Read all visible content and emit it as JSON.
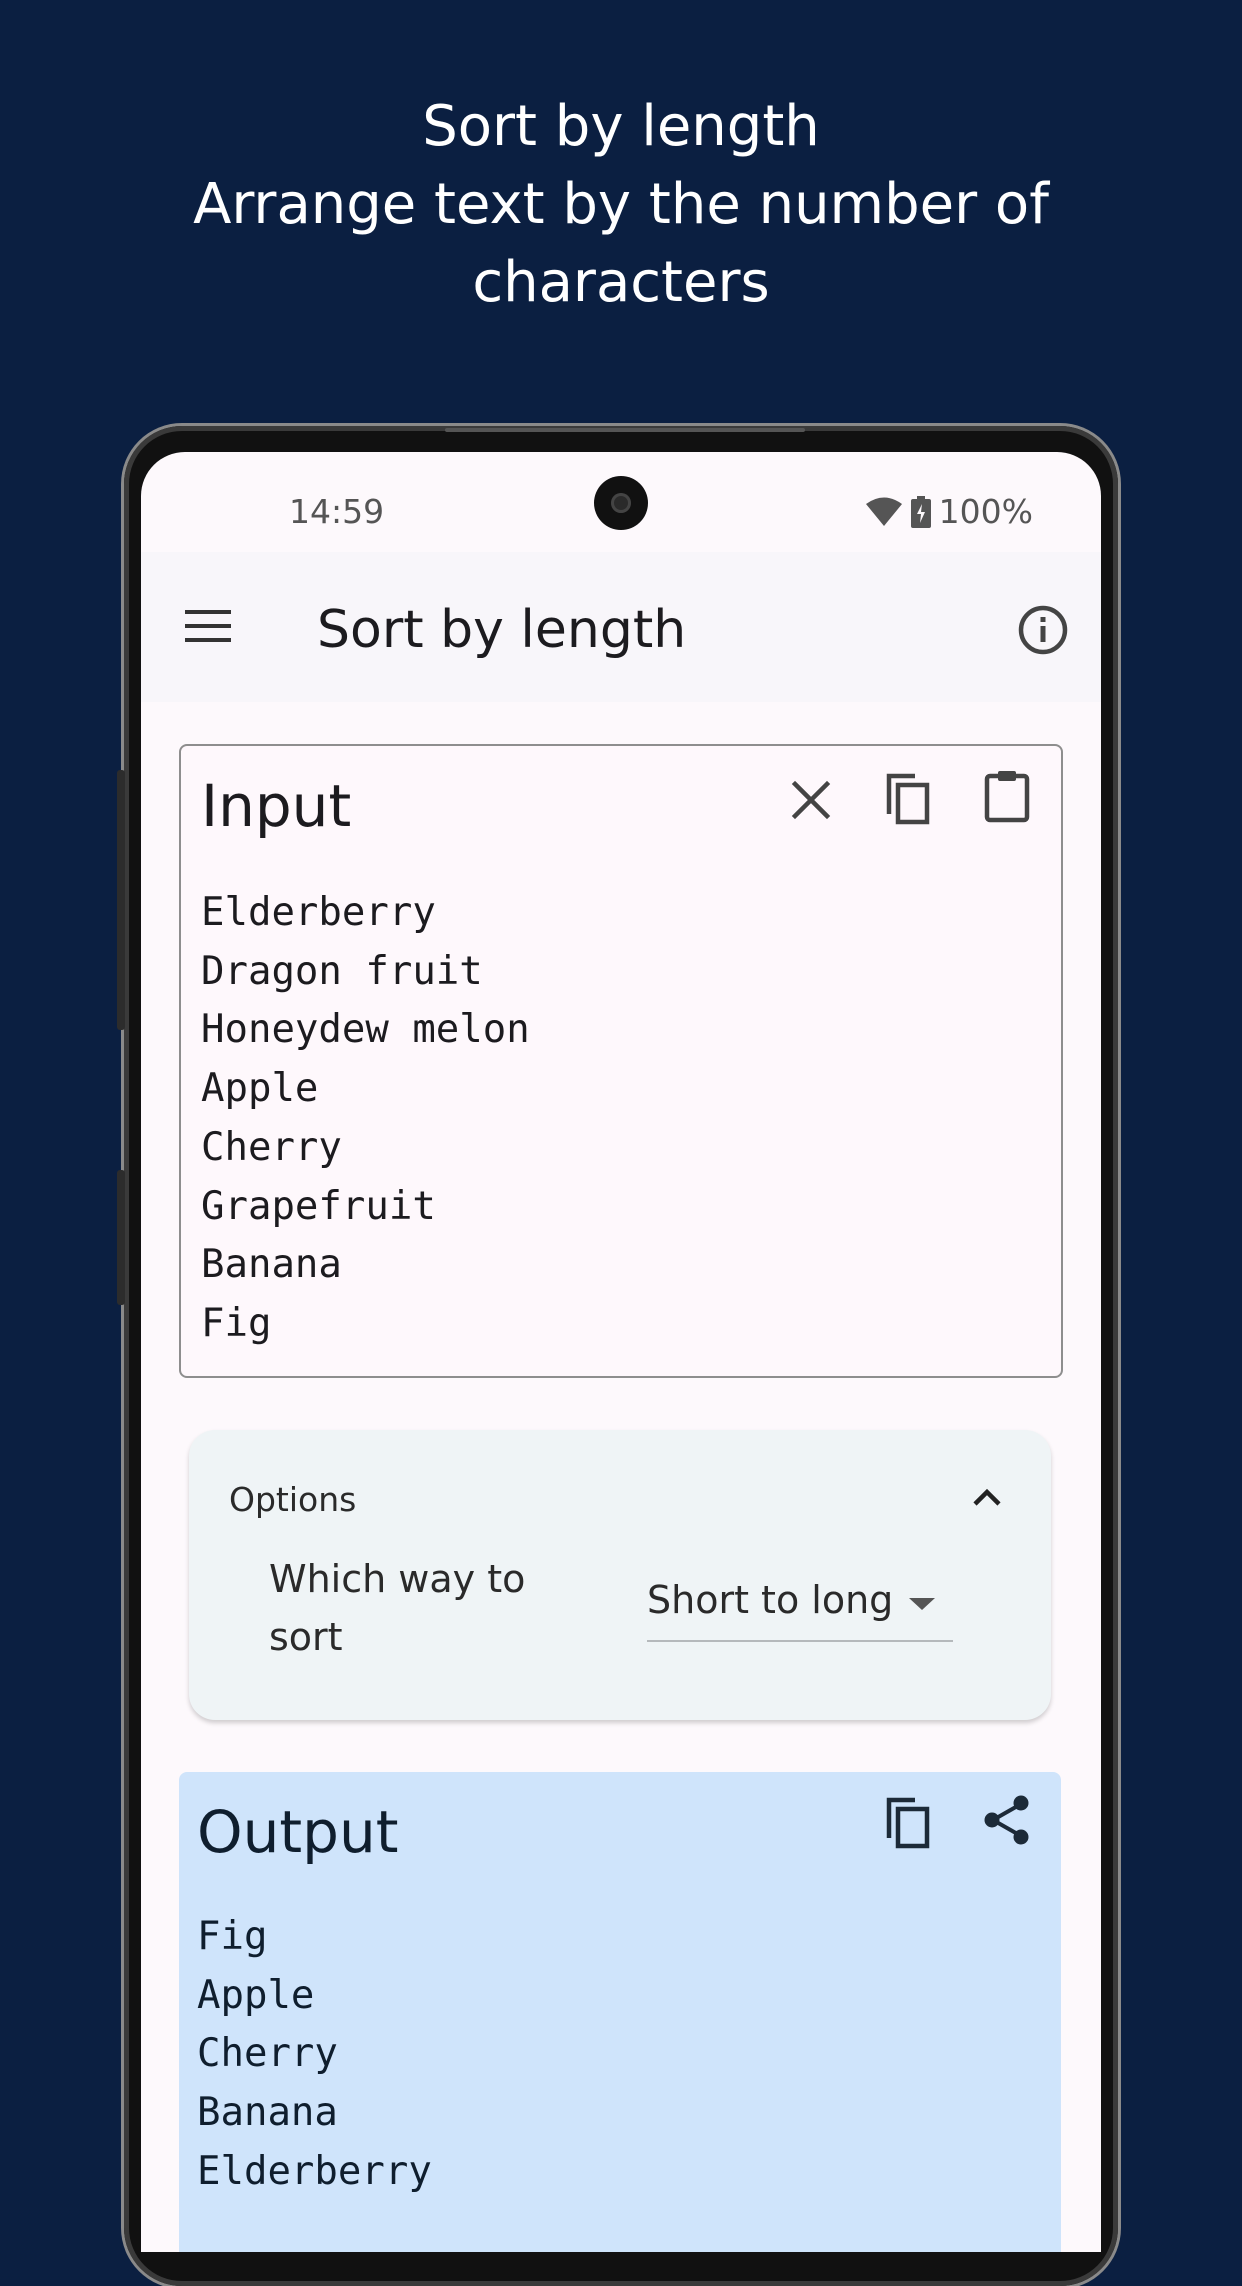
{
  "promo": {
    "line1": "Sort by length",
    "line2": "Arrange text by the number of",
    "line3": "characters"
  },
  "status_bar": {
    "time": "14:59",
    "battery": "100%",
    "icons": [
      "wifi-icon",
      "battery-icon"
    ]
  },
  "appbar": {
    "title": "Sort by length",
    "icons": [
      "menu-icon",
      "info-icon"
    ]
  },
  "input": {
    "title": "Input",
    "icons": [
      "clear-icon",
      "copy-icon",
      "paste-icon"
    ],
    "lines": [
      "Elderberry",
      "Dragon fruit",
      "Honeydew melon",
      "Apple",
      "Cherry",
      "Grapefruit",
      "Banana",
      "Fig"
    ]
  },
  "options": {
    "title": "Options",
    "sort_label": "Which way to sort",
    "sort_value": "Short to long",
    "icons": [
      "chevron-up-icon",
      "dropdown-arrow-icon"
    ]
  },
  "output": {
    "title": "Output",
    "icons": [
      "copy-icon",
      "share-icon"
    ],
    "lines": [
      "Fig",
      "Apple",
      "Cherry",
      "Banana",
      "Elderberry"
    ]
  },
  "colors": {
    "background": "#0b1f41",
    "screen": "#fdf9fc",
    "options_bg": "#eff4f6",
    "output_bg": "#cfe4fb"
  }
}
